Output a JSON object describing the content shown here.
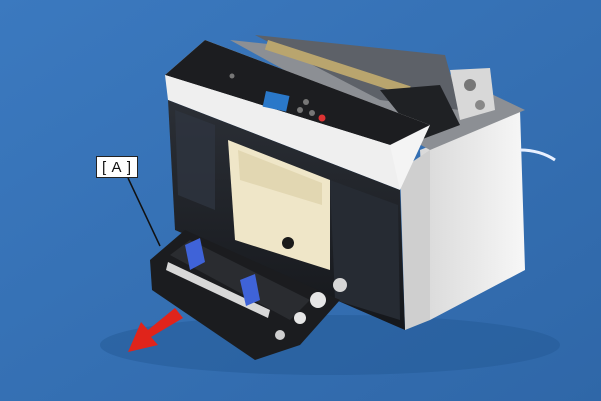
{
  "callout": {
    "label": "[ A ]"
  },
  "colors": {
    "background": "#3a75b8",
    "printer_body": "#f2f2f2",
    "printer_dark": "#1e1f22",
    "arrow": "#e0241b",
    "guide_blue": "#3f63d8",
    "paper_tray": "#efe6c8"
  }
}
